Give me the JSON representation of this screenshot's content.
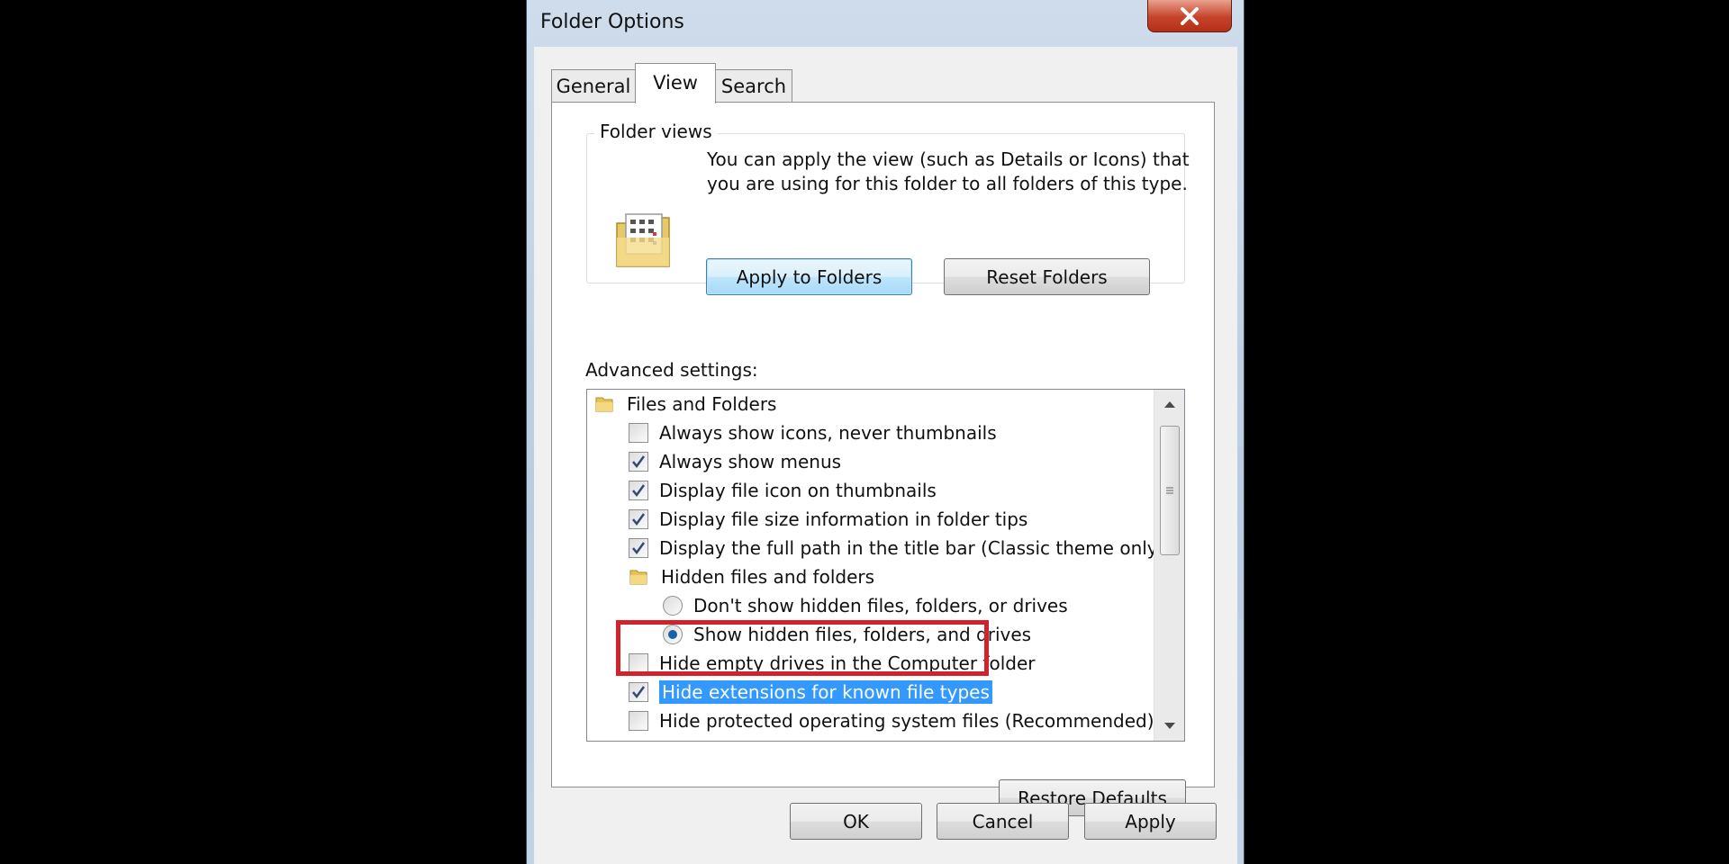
{
  "window": {
    "title": "Folder Options",
    "close_icon": "close-icon"
  },
  "tabs": [
    {
      "label": "General",
      "active": false
    },
    {
      "label": "View",
      "active": true
    },
    {
      "label": "Search",
      "active": false
    }
  ],
  "folder_views": {
    "legend": "Folder views",
    "description": "You can apply the view (such as Details or Icons) that you are using for this folder to all folders of this type.",
    "apply_button": "Apply to Folders",
    "reset_button": "Reset Folders"
  },
  "advanced": {
    "label": "Advanced settings:",
    "items": [
      {
        "type": "folder",
        "label": "Files and Folders"
      },
      {
        "type": "checkbox",
        "label": "Always show icons, never thumbnails",
        "checked": false
      },
      {
        "type": "checkbox",
        "label": "Always show menus",
        "checked": true
      },
      {
        "type": "checkbox",
        "label": "Display file icon on thumbnails",
        "checked": true
      },
      {
        "type": "checkbox",
        "label": "Display file size information in folder tips",
        "checked": true
      },
      {
        "type": "checkbox",
        "label": "Display the full path in the title bar (Classic theme only)",
        "checked": true
      },
      {
        "type": "folder",
        "label": "Hidden files and folders"
      },
      {
        "type": "radio",
        "label": "Don't show hidden files, folders, or drives",
        "checked": false
      },
      {
        "type": "radio",
        "label": "Show hidden files, folders, and drives",
        "checked": true
      },
      {
        "type": "checkbox",
        "label": "Hide empty drives in the Computer folder",
        "checked": false
      },
      {
        "type": "checkbox",
        "label": "Hide extensions for known file types",
        "checked": true,
        "selected": true
      },
      {
        "type": "checkbox",
        "label": "Hide protected operating system files (Recommended)",
        "checked": false
      }
    ]
  },
  "restore_defaults": "Restore Defaults",
  "footer": {
    "ok": "OK",
    "cancel": "Cancel",
    "apply": "Apply"
  },
  "colors": {
    "selection": "#3399ff",
    "annotation": "#d0232b",
    "close_button": "#c6432a"
  }
}
